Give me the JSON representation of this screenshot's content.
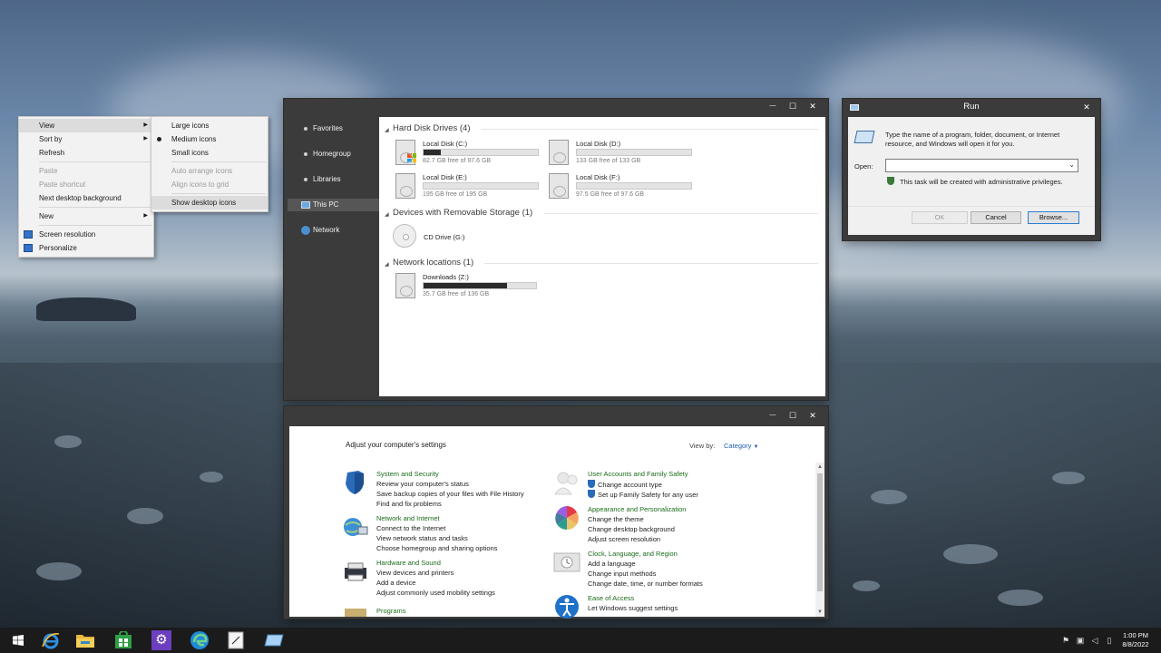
{
  "context_menu": {
    "items": [
      {
        "label": "View",
        "arrow": true,
        "highlight": true
      },
      {
        "label": "Sort by",
        "arrow": true
      },
      {
        "label": "Refresh"
      },
      {
        "sep": true
      },
      {
        "label": "Paste",
        "disabled": true
      },
      {
        "label": "Paste shortcut",
        "disabled": true
      },
      {
        "label": "Next desktop background"
      },
      {
        "sep": true
      },
      {
        "label": "New",
        "arrow": true
      },
      {
        "sep": true
      },
      {
        "label": "Screen resolution",
        "icon": "display-icon"
      },
      {
        "label": "Personalize",
        "icon": "personalize-icon"
      }
    ],
    "view_submenu": [
      {
        "label": "Large icons"
      },
      {
        "label": "Medium icons",
        "selected": true
      },
      {
        "label": "Small icons"
      },
      {
        "sep": true
      },
      {
        "label": "Auto arrange icons",
        "disabled": true
      },
      {
        "label": "Align icons to grid",
        "disabled": true
      },
      {
        "sep": true
      },
      {
        "label": "Show desktop icons",
        "highlight": true
      }
    ]
  },
  "explorer": {
    "caption": {
      "minimize": "—",
      "maximize": "☐",
      "close": "✕"
    },
    "nav": [
      "Favorites",
      "Homegroup",
      "Libraries",
      "This PC",
      "Network"
    ],
    "selected_nav": "This PC",
    "groups": {
      "hdd": "Hard Disk Drives (4)",
      "removable": "Devices with Removable Storage (1)",
      "network": "Network locations (1)"
    },
    "drives": [
      {
        "name": "Local Disk (C:)",
        "free": "82.7 GB free of 97.6 GB",
        "used_fraction": 0.15
      },
      {
        "name": "Local Disk (D:)",
        "free": "133 GB free of 133 GB",
        "used_fraction": 0.0
      },
      {
        "name": "Local Disk (E:)",
        "free": "195 GB free of 195 GB",
        "used_fraction": 0.0
      },
      {
        "name": "Local Disk (F:)",
        "free": "97.5 GB free of 97.6 GB",
        "used_fraction": 0.0
      }
    ],
    "cd_drive": "CD Drive (G:)",
    "network_drive": {
      "name": "Downloads (Z:)",
      "free": "35.7 GB free of 136 GB",
      "used_fraction": 0.74
    }
  },
  "run": {
    "title": "Run",
    "close": "✕",
    "description": "Type the name of a program, folder, document, or Internet resource, and Windows will open it for you.",
    "open_label": "Open:",
    "open_value": "",
    "admin_note": "This task will be created with administrative privileges.",
    "ok": "OK",
    "cancel": "Cancel",
    "browse": "Browse..."
  },
  "control_panel": {
    "caption": {
      "minimize": "—",
      "maximize": "☐",
      "close": "✕"
    },
    "heading": "Adjust your computer's settings",
    "view_by_label": "View by:",
    "view_by_value": "Category",
    "categories_left": [
      {
        "title": "System and Security",
        "icon": "shield-icon",
        "links": [
          "Review your computer's status",
          "Save backup copies of your files with File History",
          "Find and fix problems"
        ]
      },
      {
        "title": "Network and Internet",
        "icon": "network-globe-icon",
        "links": [
          "Connect to the Internet",
          "View network status and tasks",
          "Choose homegroup and sharing options"
        ]
      },
      {
        "title": "Hardware and Sound",
        "icon": "printer-icon",
        "links": [
          "View devices and printers",
          "Add a device",
          "Adjust commonly used mobility settings"
        ]
      },
      {
        "title": "Programs",
        "icon": "programs-icon",
        "links": []
      }
    ],
    "categories_right": [
      {
        "title": "User Accounts and Family Safety",
        "icon": "users-icon",
        "links": [
          "Change account type",
          "Set up Family Safety for any user"
        ],
        "shield_links": true
      },
      {
        "title": "Appearance and Personalization",
        "icon": "color-wheel-icon",
        "links": [
          "Change the theme",
          "Change desktop background",
          "Adjust screen resolution"
        ]
      },
      {
        "title": "Clock, Language, and Region",
        "icon": "clock-icon",
        "links": [
          "Add a language",
          "Change input methods",
          "Change date, time, or number formats"
        ]
      },
      {
        "title": "Ease of Access",
        "icon": "accessibility-icon",
        "links": [
          "Let Windows suggest settings"
        ]
      }
    ]
  },
  "taskbar": {
    "apps": [
      "start-icon",
      "internet-explorer-icon",
      "file-explorer-icon",
      "store-icon",
      "settings-icon",
      "edge-icon",
      "notepad-icon",
      "run-icon"
    ],
    "time": "1:00 PM",
    "date": "8/8/2022"
  },
  "colors": {
    "accent": "#1a6b1a",
    "window_chrome": "#3b3b3b",
    "taskbar": "#1b1b1b"
  }
}
